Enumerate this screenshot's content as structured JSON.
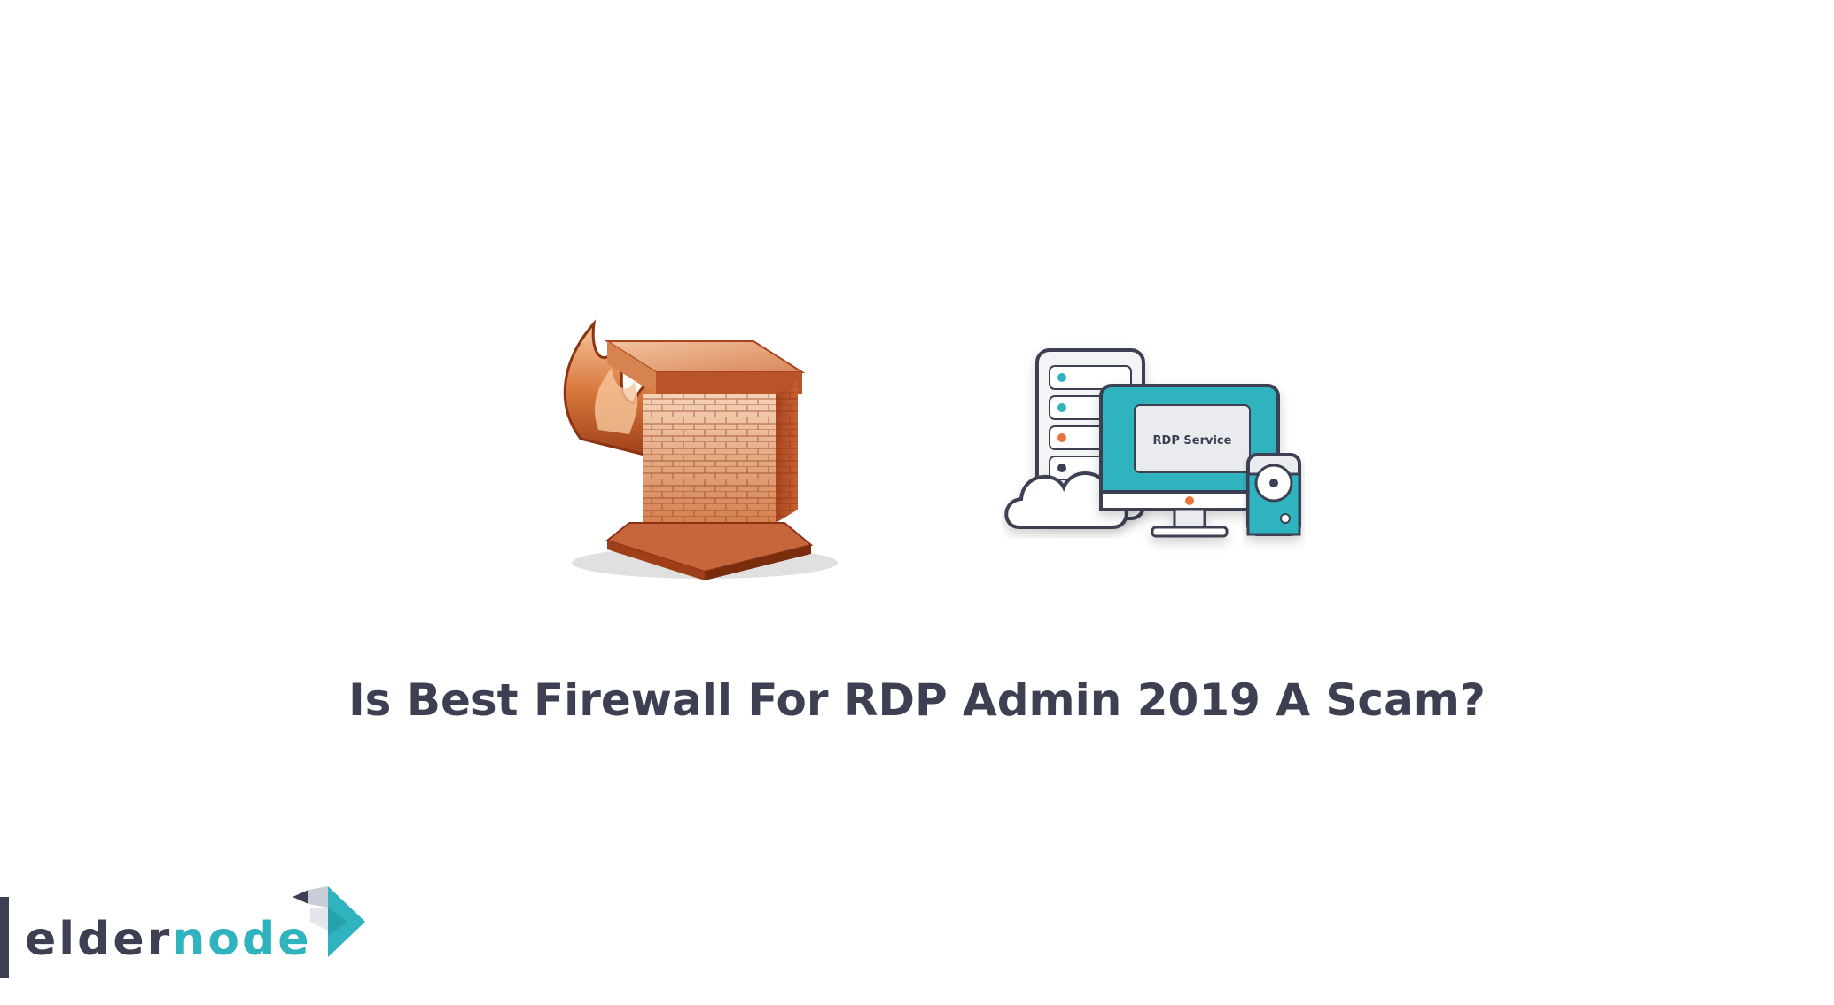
{
  "headline": "Is Best Firewall For RDP Admin 2019 A Scam?",
  "illustrations": {
    "firewall": {
      "icon": "firewall-icon"
    },
    "rdp": {
      "icon": "rdp-service-icon",
      "screen_label": "RDP Service"
    }
  },
  "brand": {
    "name_part_1": "elder",
    "name_part_2": "node",
    "colors": {
      "dark": "#3d4053",
      "accent": "#2fb3bf",
      "brick": "#c0653a"
    }
  }
}
